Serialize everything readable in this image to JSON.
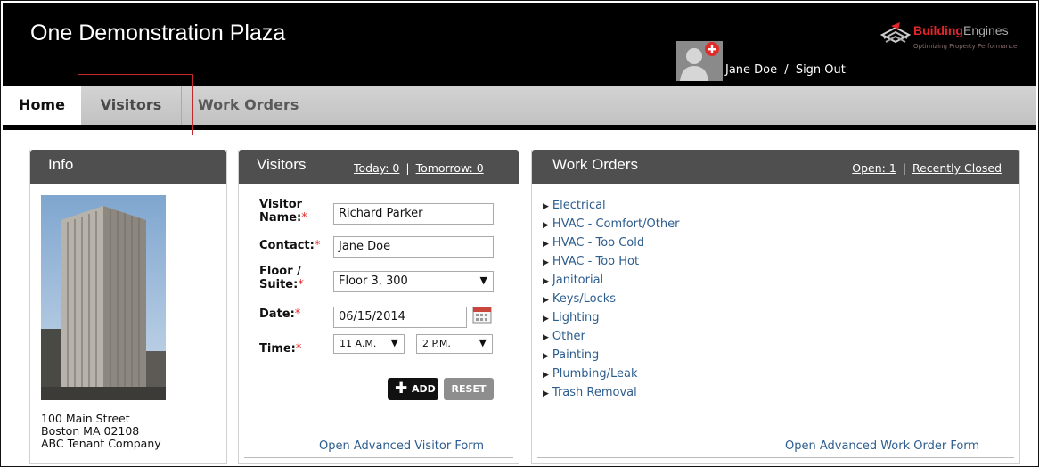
{
  "header": {
    "site_title": "One Demonstration Plaza",
    "user_name": "Jane Doe",
    "separator": "/",
    "sign_out": "Sign Out",
    "logo_word_a": "Building",
    "logo_word_b": "Engines",
    "logo_tagline": "Optimizing Property Performance"
  },
  "nav": {
    "home": "Home",
    "visitors": "Visitors",
    "work_orders": "Work Orders"
  },
  "info": {
    "title": "Info",
    "address_line1": "100 Main Street",
    "address_line2": "Boston MA 02108",
    "tenant": "ABC Tenant Company"
  },
  "visitors": {
    "title": "Visitors",
    "today_link": "Today: 0",
    "link_sep": "|",
    "tomorrow_link": "Tomorrow: 0",
    "visitor_name_label": "Visitor Name:",
    "visitor_name_value": "Richard Parker",
    "contact_label": "Contact:",
    "contact_value": "Jane Doe",
    "floor_label": "Floor / Suite:",
    "floor_value": "Floor 3, 300",
    "date_label": "Date:",
    "date_value": "06/15/2014",
    "time_label": "Time:",
    "time_start": "11 A.M.",
    "time_end": "2 P.M.",
    "required_mark": "*",
    "add_button": "ADD",
    "reset_button": "RESET",
    "advanced_link": "Open Advanced Visitor Form"
  },
  "work_orders": {
    "title": "Work Orders",
    "open_link": "Open: 1",
    "link_sep": "|",
    "recently_closed_link": "Recently Closed",
    "categories": [
      "Electrical",
      "HVAC - Comfort/Other",
      "HVAC - Too Cold",
      "HVAC - Too Hot",
      "Janitorial",
      "Keys/Locks",
      "Lighting",
      "Other",
      "Painting",
      "Plumbing/Leak",
      "Trash Removal"
    ],
    "advanced_link": "Open Advanced Work Order Form"
  },
  "colors": {
    "header_bg": "#000000",
    "panel_header_bg": "#4f4f4f",
    "link_blue": "#2d5d8e",
    "required_red": "#e52b2b",
    "highlight_red": "#c0282b"
  },
  "icons": [
    "user-avatar-icon",
    "add-plus-icon",
    "calendar-icon",
    "building-engines-logo",
    "triangle-right-icon",
    "chevron-down-icon"
  ]
}
